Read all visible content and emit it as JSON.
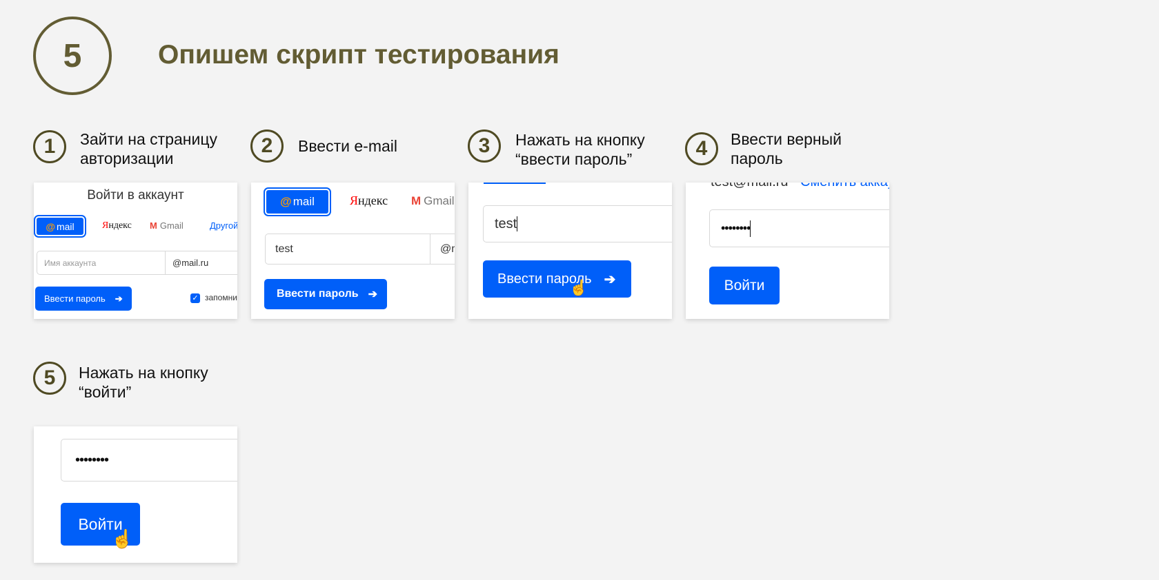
{
  "header": {
    "number": "5",
    "title": "Опишем скрипт тестирования"
  },
  "steps": [
    {
      "number": "1",
      "text": "Зайти на страницу\nавторизации"
    },
    {
      "number": "2",
      "text": "Ввести e-mail"
    },
    {
      "number": "3",
      "text": "Нажать на кнопку\n“ввести пароль”"
    },
    {
      "number": "4",
      "text": "Ввести верный\nпароль"
    },
    {
      "number": "5",
      "text": "Нажать на кнопку\n“войти”"
    }
  ],
  "card1": {
    "heading": "Войти в аккаунт",
    "mail_label": "mail",
    "mail_at": "@",
    "yandex_first": "Я",
    "yandex_rest": "ндекс",
    "gmail_m": "M",
    "gmail_label": "Gmail",
    "other_label": "Другой",
    "account_placeholder": "Имя аккаунта",
    "domain": "@mail.ru",
    "button": "Ввести пароль",
    "arrow": "➔",
    "remember": "запомнить"
  },
  "card2": {
    "mail_label": "mail",
    "mail_at": "@",
    "yandex_first": "Я",
    "yandex_rest": "ндекс",
    "gmail_m": "M",
    "gmail_label": "Gmail",
    "login_value": "test",
    "domain": "@mail.ru",
    "button": "Ввести пароль",
    "arrow": "➔"
  },
  "card3": {
    "login_value": "test",
    "button": "Ввести пароль",
    "arrow": "➔"
  },
  "card4": {
    "account": "test@mail.ru",
    "change_link": "Сменить аккаунт",
    "password": "••••••••",
    "button": "Войти"
  },
  "card5": {
    "password": "••••••••",
    "button": "Войти"
  },
  "colors": {
    "accent": "#625c33",
    "button_blue": "#005ff9"
  }
}
